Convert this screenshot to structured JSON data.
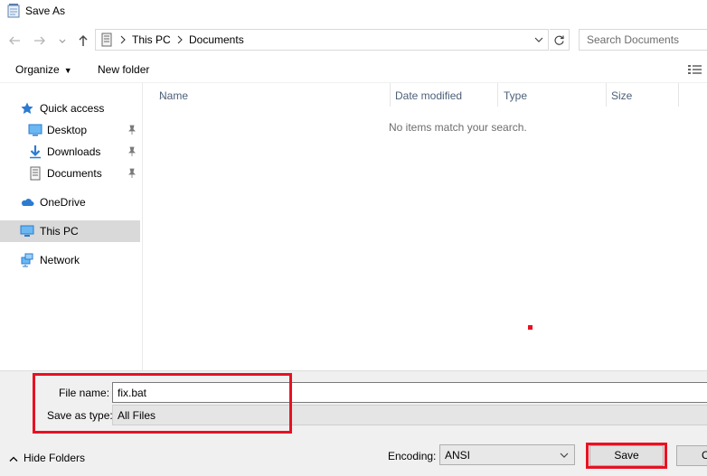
{
  "window": {
    "title": "Save As"
  },
  "nav": {
    "breadcrumbs": [
      "This PC",
      "Documents"
    ],
    "search_placeholder": "Search Documents"
  },
  "toolbar": {
    "organize": "Organize",
    "new_folder": "New folder"
  },
  "sidebar": {
    "items": [
      {
        "label": "Quick access",
        "icon": "star-icon"
      },
      {
        "label": "Desktop",
        "icon": "desktop-icon",
        "pinned": true
      },
      {
        "label": "Downloads",
        "icon": "download-icon",
        "pinned": true
      },
      {
        "label": "Documents",
        "icon": "document-icon",
        "pinned": true
      },
      {
        "label": "OneDrive",
        "icon": "cloud-icon"
      },
      {
        "label": "This PC",
        "icon": "computer-icon",
        "selected": true
      },
      {
        "label": "Network",
        "icon": "network-icon"
      }
    ]
  },
  "main": {
    "columns": [
      "Name",
      "Date modified",
      "Type",
      "Size"
    ],
    "empty_message": "No items match your search."
  },
  "form": {
    "file_name_label": "File name:",
    "file_name_value": "fix.bat",
    "save_type_label": "Save as type:",
    "save_type_value": "All Files",
    "encoding_label": "Encoding:",
    "encoding_value": "ANSI"
  },
  "footer": {
    "hide_folders": "Hide Folders",
    "save": "Save",
    "cancel": "Cancel"
  },
  "colors": {
    "highlight": "#e81123",
    "selected_bg": "#d9d9d9",
    "header_text": "#4c607a"
  }
}
